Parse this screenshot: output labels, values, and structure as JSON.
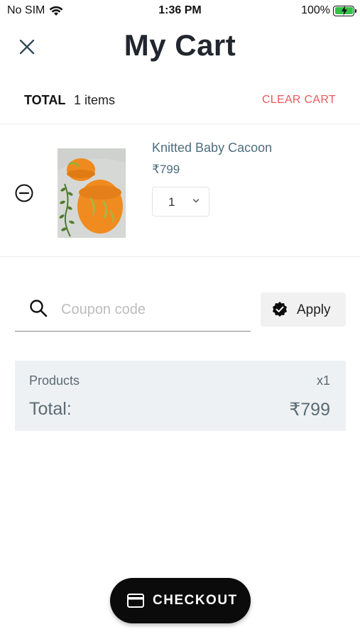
{
  "status_bar": {
    "carrier": "No SIM",
    "time": "1:36 PM",
    "battery_percent": "100%",
    "battery_level": 1.0,
    "charging": true,
    "wifi_icon": "wifi-icon",
    "battery_color": "#33c14a"
  },
  "header": {
    "title": "My Cart",
    "close_icon": "close-icon"
  },
  "summary": {
    "total_label": "TOTAL",
    "items_count": "1 items",
    "clear_cart_label": "CLEAR CART",
    "clear_cart_color": "#e85a5a"
  },
  "cart_items": [
    {
      "name": "Knitted Baby Cacoon",
      "price": "₹799",
      "quantity": "1",
      "remove_icon": "remove-circle-icon",
      "image": "orange knitted baby cocoon with hat on green vine"
    }
  ],
  "coupon": {
    "placeholder": "Coupon code",
    "value": "",
    "apply_label": "Apply",
    "apply_icon": "verified-badge-icon"
  },
  "totals": {
    "products_label": "Products",
    "products_qty": "x1",
    "total_label": "Total:",
    "total_amount": "₹799"
  },
  "checkout": {
    "label": "CHECKOUT",
    "icon": "credit-card-icon",
    "background": "#0b0b0b"
  }
}
